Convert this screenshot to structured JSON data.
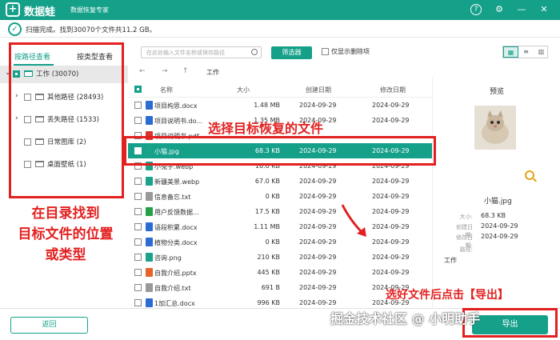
{
  "titlebar": {
    "app_name": "数据蛙",
    "subtitle": "数据恢复专家",
    "help": "?",
    "settings": "⚙",
    "minimize": "—",
    "close": "✕"
  },
  "status": {
    "text": "扫描完成。找到30070个文件共11.2 GB。"
  },
  "tabs": {
    "by_path": "按路径查看",
    "by_type": "按类型查看"
  },
  "tree": [
    {
      "label": "工作 (30070)"
    },
    {
      "label": "其他路径 (28493)"
    },
    {
      "label": "丢失路径 (1533)"
    },
    {
      "label": "日常图库 (2)"
    },
    {
      "label": "桌面壁纸 (1)"
    }
  ],
  "toolbar": {
    "search_placeholder": "在此处输入文件名称或保存路径",
    "filter": "筛选器",
    "only_deleted": "仅显示删除项"
  },
  "nav": {
    "back": "←",
    "forward": "→",
    "up": "↑",
    "path": "工作"
  },
  "columns": {
    "name": "名称",
    "size": "大小",
    "created": "创建日期",
    "modified": "修改日期"
  },
  "files": [
    {
      "name": "项目构思.docx",
      "size": "1.48 MB",
      "created": "2024-09-29",
      "modified": "2024-09-29",
      "color": "#2b6cd4"
    },
    {
      "name": "项目说明书.do...",
      "size": "1.35 MB",
      "created": "2024-09-29",
      "modified": "2024-09-29",
      "color": "#2b6cd4"
    },
    {
      "name": "项目说明书.pdf",
      "size": "",
      "created": "",
      "modified": "",
      "color": "#d9322b"
    },
    {
      "name": "小猫.jpg",
      "size": "68.3 KB",
      "created": "2024-09-29",
      "modified": "2024-09-29",
      "color": "#1aa38a"
    },
    {
      "name": "小兔子.webp",
      "size": "16.0 KB",
      "created": "2024-09-29",
      "modified": "2024-09-29",
      "color": "#1aa38a"
    },
    {
      "name": "新疆美景.webp",
      "size": "67.0 KB",
      "created": "2024-09-29",
      "modified": "2024-09-29",
      "color": "#1aa38a"
    },
    {
      "name": "信息备忘.txt",
      "size": "0 KB",
      "created": "2024-09-29",
      "modified": "2024-09-29",
      "color": "#999999"
    },
    {
      "name": "用户反馈数据...",
      "size": "17.5 KB",
      "created": "2024-09-29",
      "modified": "2024-09-29",
      "color": "#24a148"
    },
    {
      "name": "语段积累.docx",
      "size": "1.11 MB",
      "created": "2024-09-29",
      "modified": "2024-09-29",
      "color": "#2b6cd4"
    },
    {
      "name": "植物分类.docx",
      "size": "0 KB",
      "created": "2024-09-29",
      "modified": "2024-09-29",
      "color": "#2b6cd4"
    },
    {
      "name": "咨询.png",
      "size": "210 KB",
      "created": "2024-09-29",
      "modified": "2024-09-29",
      "color": "#1aa38a"
    },
    {
      "name": "自我介绍.pptx",
      "size": "445 KB",
      "created": "2024-09-29",
      "modified": "2024-09-29",
      "color": "#e8632a"
    },
    {
      "name": "自我介绍.txt",
      "size": "691 B",
      "created": "2024-09-29",
      "modified": "2024-09-29",
      "color": "#999999"
    },
    {
      "name": "1加汇总.docx",
      "size": "996 KB",
      "created": "2024-09-29",
      "modified": "2024-09-29",
      "color": "#2b6cd4"
    }
  ],
  "preview": {
    "title": "预览",
    "name": "小猫.jpg",
    "size_label": "大小:",
    "size": "68.3 KB",
    "created_label": "创建日期:",
    "created": "2024-09-29",
    "modified_label": "修改日期:",
    "modified": "2024-09-29",
    "path_label": "路径:",
    "path": "工作"
  },
  "bottom": {
    "back": "返回",
    "export": "导出"
  },
  "annotations": {
    "select_file": "选择目标恢复的文件",
    "find_location": "在目录找到\n目标文件的位置\n或类型",
    "export_hint": "选好文件后点击【导出】"
  },
  "watermark": "掘金技术社区 @ 小明助手",
  "colors": {
    "accent": "#15a08a",
    "annotation": "#e32020"
  }
}
